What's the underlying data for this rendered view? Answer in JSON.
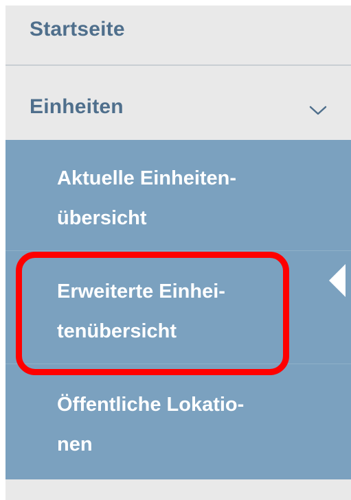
{
  "nav": {
    "start_label": "Startseite",
    "units_label": "Einheiten",
    "chevron_icon": "chevron-down-icon",
    "submenu": [
      {
        "line1": "Aktuelle Einheiten-",
        "line2": "übersicht"
      },
      {
        "line1": "Erweiterte Einhei-",
        "line2": "tenübersicht",
        "active": true
      },
      {
        "line1": "Öffentliche Lokatio-",
        "line2": "nen"
      }
    ]
  },
  "colors": {
    "nav_background": "#e9e9e9",
    "nav_text": "#4f6f8c",
    "submenu_background": "#7ba1bf",
    "submenu_text": "#ffffff",
    "highlight": "#ff0000"
  }
}
